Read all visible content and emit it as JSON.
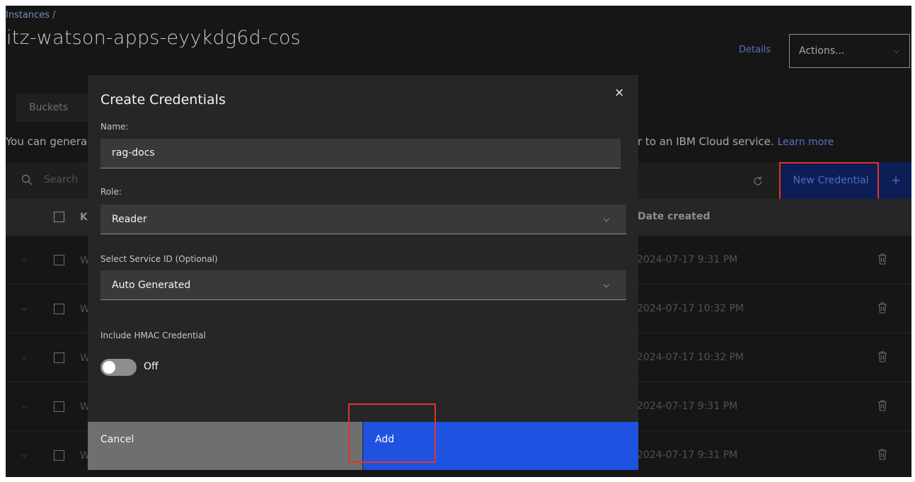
{
  "breadcrumb": {
    "root": "Instances",
    "separator": "/"
  },
  "page": {
    "title": "itz-watson-apps-eyykdg6d-cos"
  },
  "header": {
    "details_label": "Details",
    "actions_label": "Actions..."
  },
  "tabs": {
    "buckets": "Buckets"
  },
  "intro": {
    "left_text": "You can genera",
    "right_text": "r to an IBM Cloud service.",
    "learn_more": "Learn more"
  },
  "toolbar": {
    "search_placeholder": "Search",
    "new_credential_label": "New Credential",
    "add_icon": "+"
  },
  "table": {
    "headers": {
      "key": "K",
      "date_created": "Date created"
    },
    "rows": [
      {
        "name": "W",
        "date": "2024-07-17 9:31 PM"
      },
      {
        "name": "W",
        "date": "2024-07-17 10:32 PM"
      },
      {
        "name": "W",
        "date": "2024-07-17 10:32 PM"
      },
      {
        "name": "W",
        "date": "2024-07-17 9:31 PM"
      },
      {
        "name": "W",
        "date": "2024-07-17 9:31 PM"
      }
    ]
  },
  "modal": {
    "title": "Create Credentials",
    "close": "×",
    "name_label": "Name:",
    "name_value": "rag-docs",
    "role_label": "Role:",
    "role_value": "Reader",
    "service_id_label": "Select Service ID (Optional)",
    "service_id_value": "Auto Generated",
    "hmac_label": "Include HMAC Credential",
    "hmac_state": "Off",
    "cancel_label": "Cancel",
    "add_label": "Add"
  },
  "colors": {
    "primary": "#1f52e0",
    "highlight": "#e0352b",
    "background": "#161616"
  }
}
